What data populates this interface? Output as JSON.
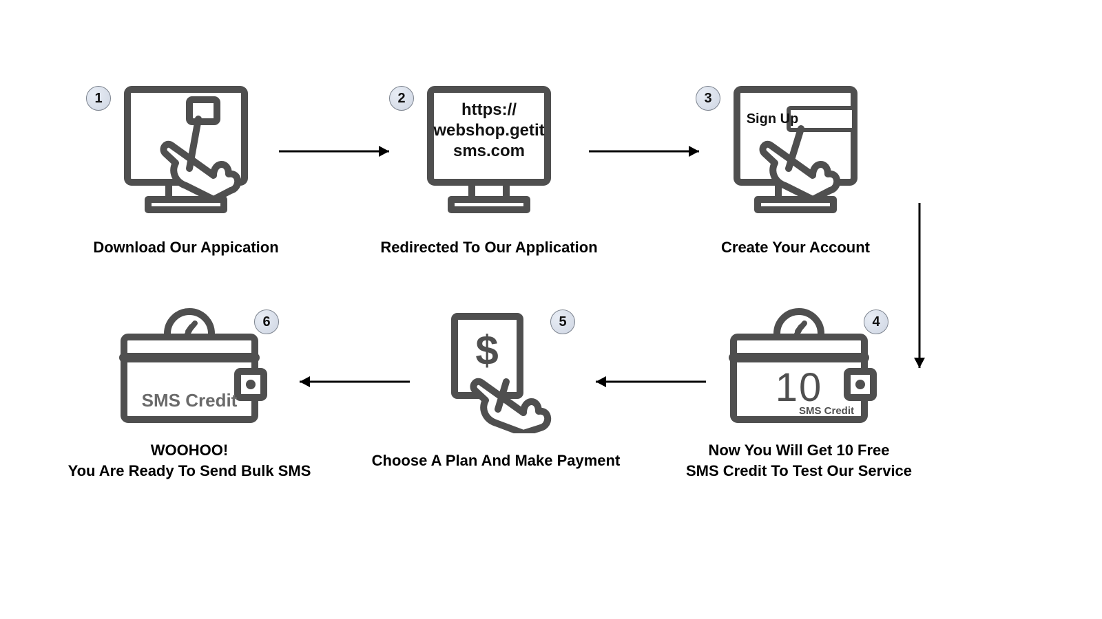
{
  "steps": {
    "s1": {
      "num": "1",
      "caption": "Download Our Appication"
    },
    "s2": {
      "num": "2",
      "caption": "Redirected To Our Application",
      "url_l1": "https://",
      "url_l2": "webshop.getit",
      "url_l3": "sms.com"
    },
    "s3": {
      "num": "3",
      "caption": "Create Your Account",
      "button": "Sign Up"
    },
    "s4": {
      "num": "4",
      "caption_l1": "Now You Will Get 10 Free",
      "caption_l2": "SMS Credit To Test Our Service",
      "wallet_num": "10",
      "wallet_sub": "SMS Credit"
    },
    "s5": {
      "num": "5",
      "caption": "Choose A Plan And Make Payment"
    },
    "s6": {
      "num": "6",
      "caption_l1": "WOOHOO!",
      "caption_l2": "You Are Ready To Send Bulk SMS",
      "wallet_text": "SMS Credit"
    }
  }
}
